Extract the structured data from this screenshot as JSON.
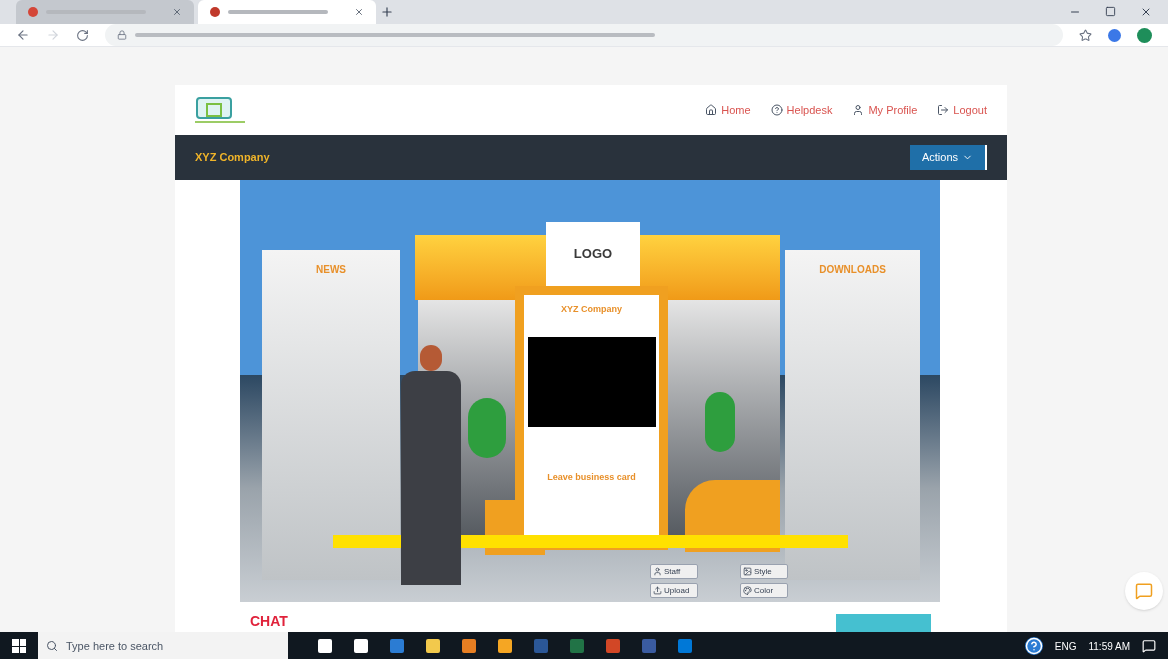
{
  "browser": {
    "tabs": [
      {
        "selected": false
      },
      {
        "selected": true
      }
    ]
  },
  "site": {
    "nav": [
      {
        "kind": "home",
        "label": "Home"
      },
      {
        "kind": "help",
        "label": "Helpdesk"
      },
      {
        "kind": "profile",
        "label": "My Profile"
      },
      {
        "kind": "logout",
        "label": "Logout"
      }
    ],
    "company_bar": {
      "title": "XYZ Company",
      "actions_button": "Actions"
    }
  },
  "booth": {
    "logo": "LOGO",
    "left_panel": "NEWS",
    "right_panel": "DOWNLOADS",
    "center_title": "XYZ Company",
    "business_card": "Leave business card",
    "tools": [
      {
        "kind": "staff",
        "label": "Staff"
      },
      {
        "kind": "style",
        "label": "Style"
      },
      {
        "kind": "upload",
        "label": "Upload"
      },
      {
        "kind": "color",
        "label": "Color"
      }
    ]
  },
  "chat_logo": "CHAT",
  "taskbar": {
    "search_placeholder": "Type here to search",
    "language": "ENG",
    "time": "11:59 AM"
  }
}
